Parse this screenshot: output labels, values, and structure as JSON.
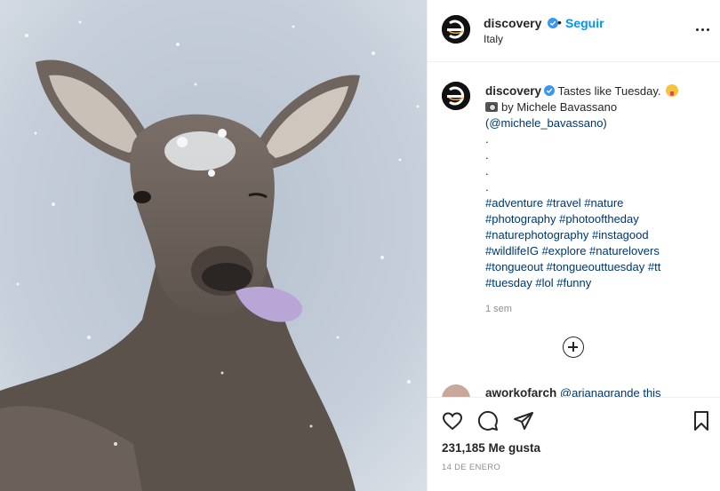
{
  "photo": {
    "alt": ""
  },
  "header": {
    "username": "discovery",
    "separator": "•",
    "follow_label": "Seguir",
    "location": "Italy"
  },
  "caption": {
    "username": "discovery",
    "text": "Tastes like Tuesday.",
    "credit": "by Michele Bavassano",
    "handle": "(@michele_bavassano)",
    "dots": [
      ".",
      ".",
      ".",
      "."
    ],
    "hashtag_lines": [
      "#adventure #travel #nature",
      "#photography #photooftheday",
      "#naturephotography #instagood",
      "#wildlifeIG #explore #naturelovers",
      "#tongueout #tongueouttuesday #tt",
      "#tuesday #lol #funny"
    ],
    "time": "1 sem"
  },
  "second_comment": {
    "username": "aworkofarch",
    "text": "@arianagrande this"
  },
  "footer": {
    "likes": "231,185 Me gusta",
    "date": "14 DE ENERO"
  },
  "colors": {
    "link_blue": "#0095f6",
    "hashtag": "#00376b",
    "muted": "#8e8e8e",
    "text": "#262626"
  }
}
